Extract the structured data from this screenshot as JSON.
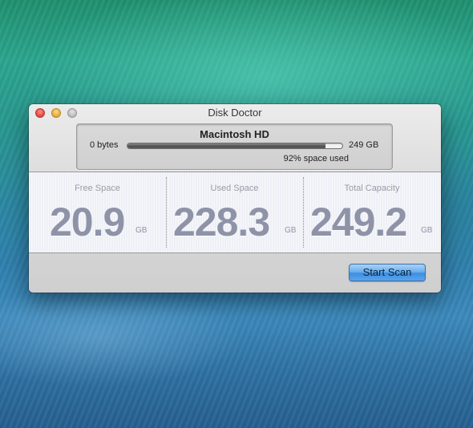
{
  "window": {
    "title": "Disk Doctor",
    "controls": [
      "close",
      "minimize",
      "zoom"
    ]
  },
  "disk": {
    "name": "Macintosh HD",
    "min_label": "0 bytes",
    "max_label": "249 GB",
    "used_fraction": 0.92,
    "percent_label": "92% space used"
  },
  "stats": [
    {
      "label": "Free Space",
      "value": "20.9",
      "unit": "GB"
    },
    {
      "label": "Used Space",
      "value": "228.3",
      "unit": "GB"
    },
    {
      "label": "Total Capacity",
      "value": "249.2",
      "unit": "GB"
    }
  ],
  "actions": {
    "start_scan_label": "Start Scan"
  },
  "colors": {
    "close": "#e0443b",
    "minimize": "#e3a932",
    "zoom": "#b9b9b9",
    "accent_button": "#4c9ae6",
    "stat_value": "#8f93a8"
  }
}
